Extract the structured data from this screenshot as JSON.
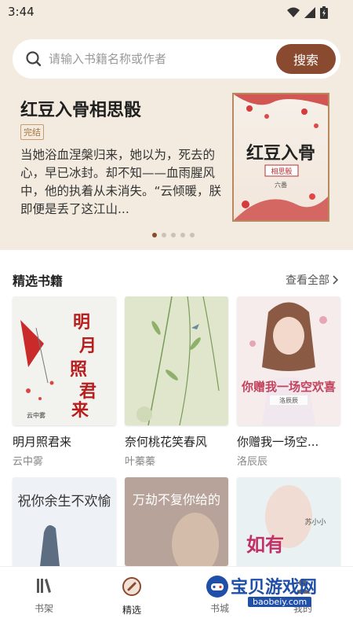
{
  "status_bar": {
    "time": "3:44"
  },
  "search": {
    "placeholder": "请输入书籍名称或作者",
    "button_label": "搜索"
  },
  "featured": {
    "title": "红豆入骨相思骰",
    "badge": "完结",
    "description": "当她浴血涅槃归来，她以为，死去的心，早已冰封。却不知——血雨腥风中，他的执着从未消失。“云倾暖，朕即便是丢了这江山...",
    "cover_text": "红豆入骨",
    "cover_seal": "相思骰",
    "cover_author": "六番",
    "carousel_dots": 5,
    "active_dot": 0
  },
  "section": {
    "title": "精选书籍",
    "see_all": "查看全部"
  },
  "books": [
    {
      "title": "明月照君来",
      "author": "云中雾",
      "cover_text": "明月照君来",
      "cover_author": "云中雾"
    },
    {
      "title": "奈何桃花笑春风",
      "author": "叶蓁蓁"
    },
    {
      "title": "你赠我一场空...",
      "author": "洛辰辰",
      "cover_text": "你赠我一场空欢喜",
      "cover_author": "洛辰辰"
    },
    {
      "cover_text": "祝你余生不欢愉"
    },
    {
      "cover_text": "万劫不复你给的"
    },
    {
      "cover_text": "如有",
      "cover_author": "苏小小"
    }
  ],
  "tabs": [
    {
      "label": "书架",
      "icon": "bookshelf-icon",
      "active": false
    },
    {
      "label": "精选",
      "icon": "selected-icon",
      "active": true
    },
    {
      "label": "书城",
      "icon": "bookstore-icon",
      "active": false
    },
    {
      "label": "我的",
      "icon": "profile-icon",
      "active": false
    }
  ],
  "watermark": {
    "text": "宝贝游戏网",
    "url": "baobeiy.com"
  },
  "colors": {
    "accent": "#8a4a2f",
    "header_bg": "#f3ebdf"
  }
}
